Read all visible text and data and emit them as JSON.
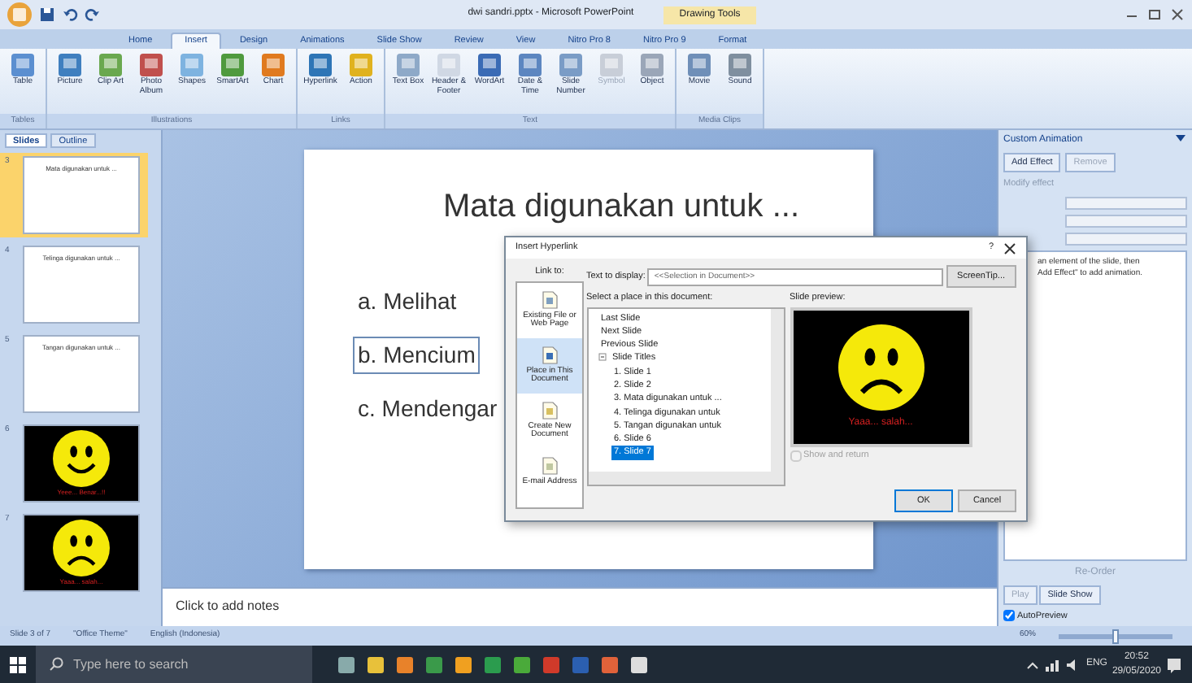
{
  "window": {
    "title": "dwi sandri.pptx - Microsoft PowerPoint",
    "context_tab": "Drawing Tools"
  },
  "ribbon": {
    "tabs": [
      {
        "label": "Home",
        "selected": false
      },
      {
        "label": "Insert",
        "selected": true
      },
      {
        "label": "Design",
        "selected": false
      },
      {
        "label": "Animations",
        "selected": false
      },
      {
        "label": "Slide Show",
        "selected": false
      },
      {
        "label": "Review",
        "selected": false
      },
      {
        "label": "View",
        "selected": false
      },
      {
        "label": "Nitro Pro 8",
        "selected": false
      },
      {
        "label": "Nitro Pro 9",
        "selected": false
      },
      {
        "label": "Format",
        "selected": false
      }
    ],
    "groups": [
      {
        "label": "Tables",
        "commands": [
          {
            "label": "Table",
            "disabled": false
          }
        ]
      },
      {
        "label": "Illustrations",
        "commands": [
          {
            "label": "Picture",
            "disabled": false
          },
          {
            "label": "Clip Art",
            "disabled": false
          },
          {
            "label": "Photo Album",
            "disabled": false
          },
          {
            "label": "Shapes",
            "disabled": false
          },
          {
            "label": "SmartArt",
            "disabled": false
          },
          {
            "label": "Chart",
            "disabled": false
          }
        ]
      },
      {
        "label": "Links",
        "commands": [
          {
            "label": "Hyperlink",
            "disabled": false
          },
          {
            "label": "Action",
            "disabled": false
          }
        ]
      },
      {
        "label": "Text",
        "commands": [
          {
            "label": "Text Box",
            "disabled": false
          },
          {
            "label": "Header & Footer",
            "disabled": false
          },
          {
            "label": "WordArt",
            "disabled": false
          },
          {
            "label": "Date & Time",
            "disabled": false
          },
          {
            "label": "Slide Number",
            "disabled": false
          },
          {
            "label": "Symbol",
            "disabled": true
          },
          {
            "label": "Object",
            "disabled": false
          }
        ]
      },
      {
        "label": "Media Clips",
        "commands": [
          {
            "label": "Movie",
            "disabled": false
          },
          {
            "label": "Sound",
            "disabled": false
          }
        ]
      }
    ]
  },
  "slides_panel": {
    "tabs": [
      {
        "label": "Slides",
        "selected": true
      },
      {
        "label": "Outline",
        "selected": false
      }
    ],
    "thumbnails": [
      {
        "number": "3",
        "selected": true,
        "kind": "text",
        "title": "Mata digunakan untuk ..."
      },
      {
        "number": "4",
        "selected": false,
        "kind": "text",
        "title": "Telinga digunakan untuk ..."
      },
      {
        "number": "5",
        "selected": false,
        "kind": "text",
        "title": "Tangan digunakan untuk ..."
      },
      {
        "number": "6",
        "selected": false,
        "kind": "smile",
        "caption": "Yeee... Benar...!!"
      },
      {
        "number": "7",
        "selected": false,
        "kind": "frown",
        "caption": "Yaaa... salah..."
      }
    ]
  },
  "slide": {
    "title": "Mata digunakan untuk ...",
    "items": [
      {
        "text": "a. Melihat",
        "selected": false
      },
      {
        "text": "b. Mencium",
        "selected": true
      },
      {
        "text": "c. Mendengar",
        "selected": false
      }
    ]
  },
  "notes": {
    "placeholder": "Click to add notes"
  },
  "dialog": {
    "title": "Insert Hyperlink",
    "help": "?",
    "link_to_label": "Link to:",
    "link_to": [
      {
        "label": "Existing File or Web Page",
        "selected": false
      },
      {
        "label": "Place in This Document",
        "selected": true
      },
      {
        "label": "Create New Document",
        "selected": false
      },
      {
        "label": "E-mail Address",
        "selected": false
      }
    ],
    "text_to_display_label": "Text to display:",
    "text_to_display": "<<Selection in Document>>",
    "screentip": "ScreenTip...",
    "place_label": "Select a place in this document:",
    "places": [
      {
        "label": "Last Slide",
        "selected": false
      },
      {
        "label": "Next Slide",
        "selected": false
      },
      {
        "label": "Previous Slide",
        "selected": false
      },
      {
        "label": "Slide Titles",
        "selected": false,
        "expanded": true,
        "children": [
          {
            "label": "1. Slide 1",
            "selected": false
          },
          {
            "label": "2. Slide 2",
            "selected": false
          },
          {
            "label": "3. Mata digunakan untuk ...",
            "selected": false
          },
          {
            "label": "4. Telinga digunakan untuk",
            "selected": false
          },
          {
            "label": "5. Tangan digunakan untuk",
            "selected": false
          },
          {
            "label": "6. Slide 6",
            "selected": false
          },
          {
            "label": "7. Slide 7",
            "selected": true
          }
        ]
      }
    ],
    "preview_label": "Slide preview:",
    "preview_caption": "Yaaa... salah...",
    "show_and_return": {
      "label": "Show and return",
      "checked": false,
      "disabled": true
    },
    "buttons": [
      "OK",
      "Cancel"
    ]
  },
  "task_pane": {
    "title": "Custom Animation",
    "add_effect": "Add Effect",
    "remove": "Remove",
    "modify_label": "Modify effect",
    "hint_lines": [
      "an element of the slide, then",
      "Add Effect\" to add animation."
    ],
    "reorder": "Re-Order",
    "play": "Play",
    "slide_show": "Slide Show",
    "autopreview": {
      "label": "AutoPreview",
      "checked": true
    }
  },
  "status_bar": {
    "slide": "Slide 3 of 7",
    "theme": "\"Office Theme\"",
    "language": "English (Indonesia)",
    "zoom": "60%",
    "zoom_slider": {
      "level": 0.5
    }
  },
  "taskbar": {
    "search_placeholder": "Type here to search",
    "language": "ENG",
    "time": "20:52",
    "date": "29/05/2020"
  }
}
